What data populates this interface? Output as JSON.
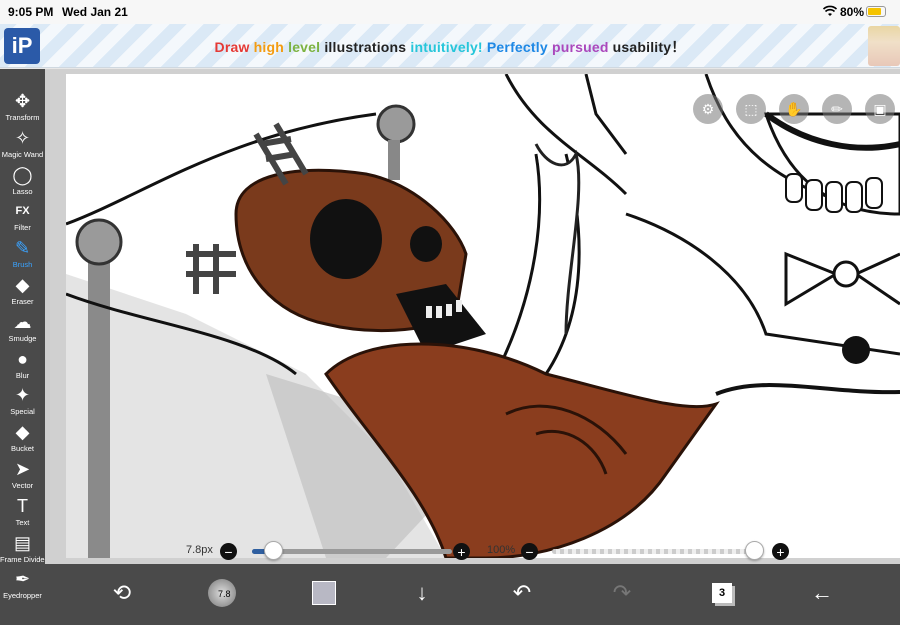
{
  "status_bar": {
    "time": "9:05 PM",
    "date": "Wed Jan 21",
    "battery": "80%",
    "battery_level": 0.8
  },
  "banner": {
    "logo_text": "iP",
    "slogan_words": [
      {
        "text": "Draw ",
        "color": "#e53935"
      },
      {
        "text": "high ",
        "color": "#f39c12"
      },
      {
        "text": "level ",
        "color": "#7cb342"
      },
      {
        "text": "illustrations ",
        "color": "#222222"
      },
      {
        "text": "intuitively! ",
        "color": "#26c6da"
      },
      {
        "text": "Perfectly ",
        "color": "#1e88e5"
      },
      {
        "text": "pursued ",
        "color": "#ab47bc"
      },
      {
        "text": "usability",
        "color": "#222222"
      },
      {
        "text": "！",
        "color": "#222222"
      }
    ]
  },
  "tools": [
    {
      "label": "Transform",
      "icon": "move-icon",
      "glyph": "✥"
    },
    {
      "label": "Magic Wand",
      "icon": "magic-wand-icon",
      "glyph": "✧"
    },
    {
      "label": "Lasso",
      "icon": "lasso-icon",
      "glyph": "◯"
    },
    {
      "label": "Filter",
      "icon": "fx-icon",
      "glyph": "FX"
    },
    {
      "label": "Brush",
      "icon": "brush-icon",
      "glyph": "✎",
      "active": true
    },
    {
      "label": "Eraser",
      "icon": "eraser-icon",
      "glyph": "◆"
    },
    {
      "label": "Smudge",
      "icon": "smudge-icon",
      "glyph": "☁"
    },
    {
      "label": "Blur",
      "icon": "drop-icon",
      "glyph": "●"
    },
    {
      "label": "Special",
      "icon": "special-icon",
      "glyph": "✦"
    },
    {
      "label": "Bucket",
      "icon": "bucket-icon",
      "glyph": "◆"
    },
    {
      "label": "Vector",
      "icon": "cursor-icon",
      "glyph": "➤"
    },
    {
      "label": "Text",
      "icon": "text-icon",
      "glyph": "T"
    },
    {
      "label": "Frame Divider",
      "icon": "frame-divider-icon",
      "glyph": "▤"
    },
    {
      "label": "Eyedropper",
      "icon": "eyedropper-icon",
      "glyph": "✒"
    }
  ],
  "overlay_buttons": [
    {
      "name": "toggle-settings-icon",
      "glyph": "⚙"
    },
    {
      "name": "selection-icon",
      "glyph": "⬚"
    },
    {
      "name": "material-icon",
      "glyph": "✋"
    },
    {
      "name": "ruler-icon",
      "glyph": "✏"
    },
    {
      "name": "reference-image-icon",
      "glyph": "▣"
    }
  ],
  "brush_size": {
    "value": "7.8px",
    "minus": "−",
    "plus": "+",
    "level": 0.03
  },
  "opacity": {
    "value": "100%",
    "minus": "−",
    "plus": "+",
    "level": 1.0
  },
  "bottom_bar": {
    "brush_size_preview": "7.8",
    "layer_count": "3",
    "color_swatch": "#b8b8c4",
    "icons": [
      "quick-menu-icon",
      "brush-size-icon",
      "color-swatch",
      "download-icon",
      "undo-icon",
      "redo-icon",
      "layers-icon",
      "back-icon"
    ]
  },
  "colors": {
    "accent": "#3aa3ff",
    "toolbar_bg": "#4a4a4a",
    "skull_brown": "#7a3a1c"
  }
}
